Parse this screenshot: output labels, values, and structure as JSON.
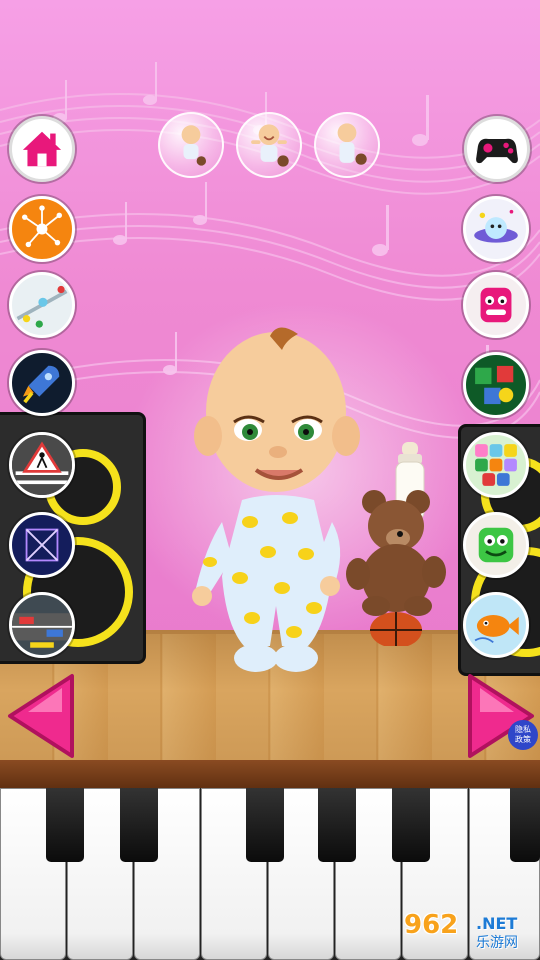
{
  "app": {
    "screen": "baby-room"
  },
  "top_bar": {
    "home_button": {
      "icon": "home-icon"
    },
    "gamepad_button": {
      "icon": "gamepad-icon"
    },
    "character_bubbles": [
      {
        "icon": "baby-sitting-icon"
      },
      {
        "icon": "baby-cheering-icon"
      },
      {
        "icon": "baby-standing-icon"
      }
    ]
  },
  "left_games": [
    {
      "icon": "orange-network-icon"
    },
    {
      "icon": "slider-puzzle-icon"
    },
    {
      "icon": "rocket-icon"
    },
    {
      "icon": "road-crossing-icon"
    },
    {
      "icon": "geometry-shape-icon"
    },
    {
      "icon": "traffic-road-icon"
    }
  ],
  "right_games": [
    {
      "icon": "space-ship-icon"
    },
    {
      "icon": "pink-monster-icon"
    },
    {
      "icon": "colorful-blocks-icon"
    },
    {
      "icon": "candy-cubes-icon"
    },
    {
      "icon": "green-monster-icon"
    },
    {
      "icon": "fish-icon"
    }
  ],
  "navigation": {
    "prev_icon": "left-arrow-icon",
    "next_icon": "right-arrow-icon"
  },
  "privacy_badge": {
    "line1": "隐私",
    "line2": "政策"
  },
  "watermark": {
    "number": "962",
    "suffix": ".NET",
    "cn": "乐游网"
  },
  "colors": {
    "wall": "#ef8ad3",
    "accent_pink": "#e8187b",
    "speaker_ring": "#f5e21c",
    "floor": "#d9a55f"
  }
}
